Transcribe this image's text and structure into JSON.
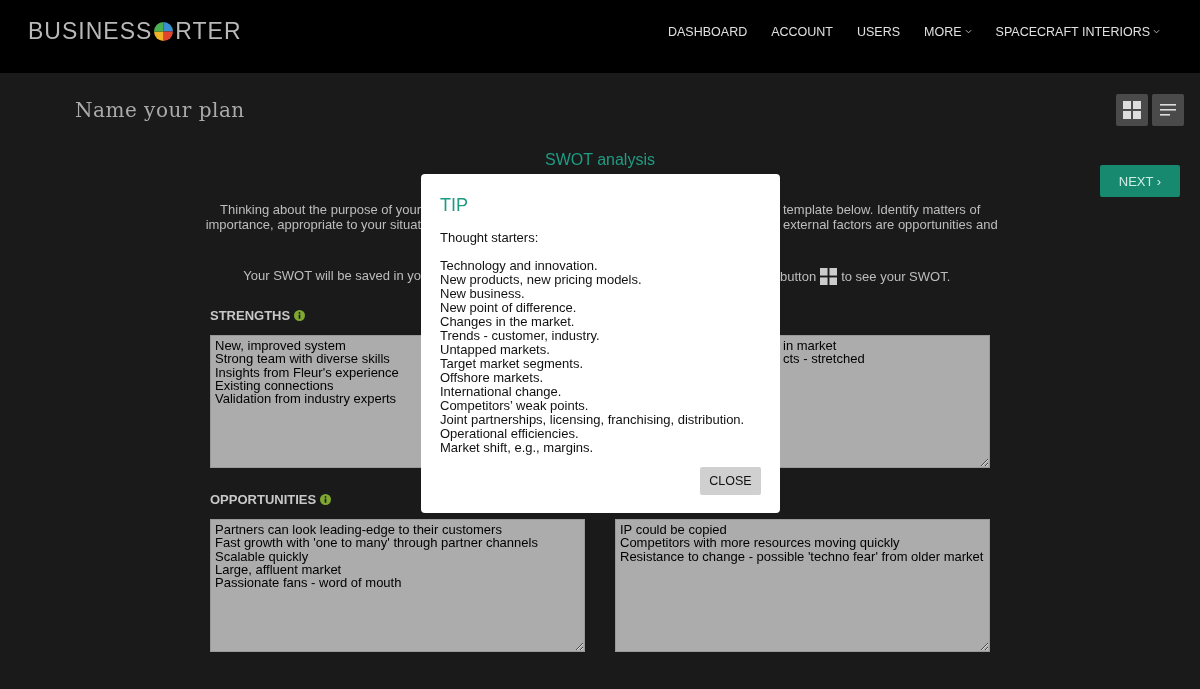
{
  "header": {
    "logo": {
      "before": "BUSINESS",
      "after": "RTER"
    },
    "nav": [
      {
        "label": "DASHBOARD",
        "dropdown": false
      },
      {
        "label": "ACCOUNT",
        "dropdown": false
      },
      {
        "label": "USERS",
        "dropdown": false
      },
      {
        "label": "MORE",
        "dropdown": true
      },
      {
        "label": "SPACECRAFT INTERIORS",
        "dropdown": true
      }
    ]
  },
  "plan": {
    "title": "Name your plan",
    "views": [
      {
        "kind": "grid"
      },
      {
        "kind": "list"
      }
    ]
  },
  "next_button": "NEXT ›",
  "swot": {
    "heading": "SWOT analysis",
    "intro_lines": [
      {
        "left": "Thinking about the purpose of your",
        "right": "template below. Identify matters of"
      },
      {
        "left": "importance, appropriate to your situat",
        "right": "external factors are opportunities and"
      }
    ],
    "save_note": {
      "left": "Your SWOT will be saved in yo",
      "right_before": "button",
      "right_after": "to see your SWOT."
    },
    "quadrants": [
      {
        "label": "STRENGTHS",
        "covered": false,
        "lines": [
          "New, improved system",
          "Strong team with diverse skills",
          "Insights from Fleur's experience",
          "Existing connections",
          "Validation from industry experts"
        ]
      },
      {
        "covered": true,
        "lines": [
          "in market",
          "cts - stretched"
        ]
      },
      {
        "label": "OPPORTUNITIES",
        "covered": false,
        "lines": [
          "Partners can look leading-edge to their customers",
          "Fast growth with 'one to many' through partner channels",
          "Scalable quickly",
          "Large, affluent market",
          "Passionate fans - word of mouth"
        ]
      },
      {
        "covered": false,
        "lines": [
          "IP could be copied",
          "Competitors with more resources moving quickly",
          "Resistance to change - possible 'techno fear' from older market"
        ]
      }
    ]
  },
  "modal": {
    "title": "TIP",
    "intro": "Thought starters:",
    "items": [
      "Technology and innovation.",
      "New products, new pricing models.",
      "New business.",
      "New point of difference.",
      "Changes in the market.",
      "Trends - customer, industry.",
      "Untapped markets.",
      "Target market segments.",
      "Offshore markets.",
      "International change.",
      "Competitors’ weak points.",
      "Joint partnerships, licensing, franchising, distribution.",
      "Operational efficiencies.",
      "Market shift, e.g., margins."
    ],
    "close": "CLOSE"
  }
}
